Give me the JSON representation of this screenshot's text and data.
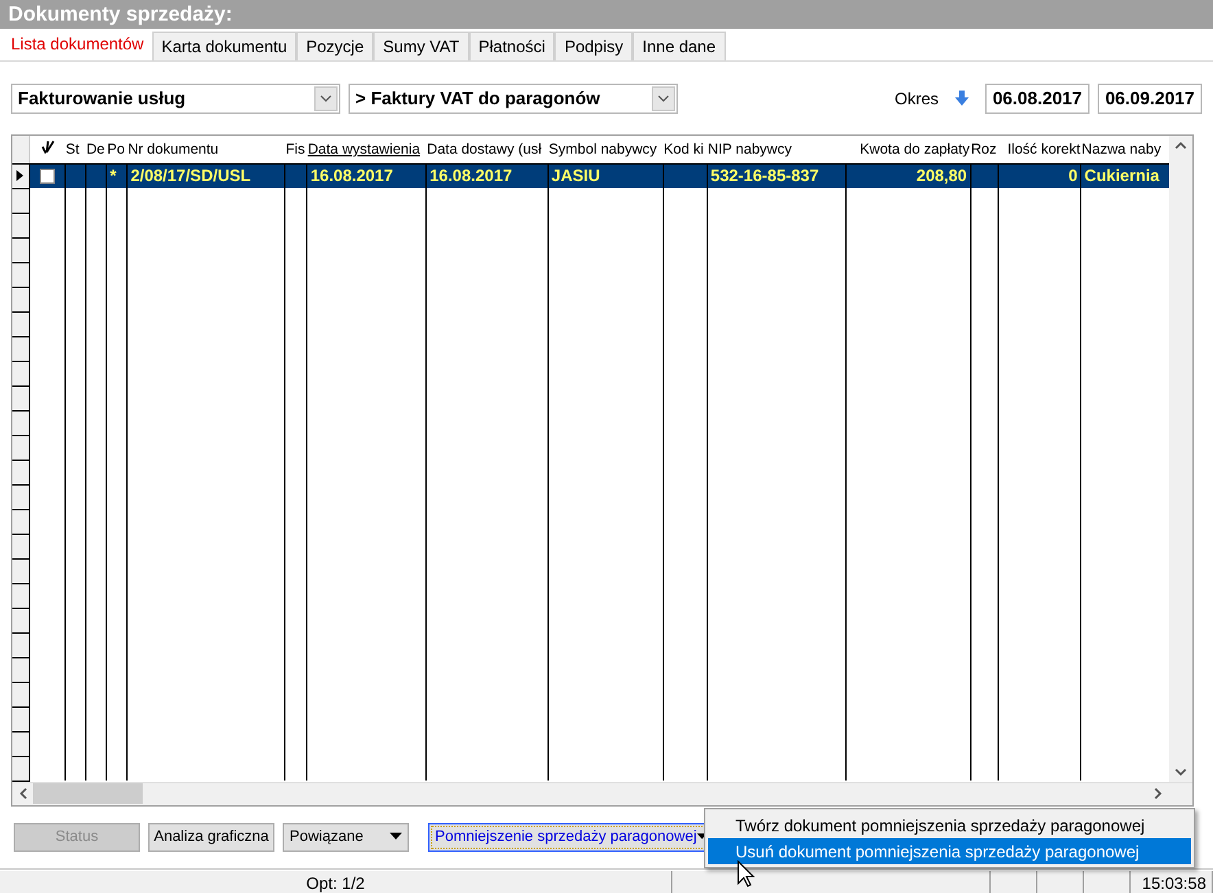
{
  "window": {
    "title": "Dokumenty sprzedaży:"
  },
  "tabs": [
    {
      "label": "Lista dokumentów",
      "selected": true
    },
    {
      "label": "Karta dokumentu",
      "selected": false
    },
    {
      "label": "Pozycje",
      "selected": false
    },
    {
      "label": "Sumy VAT",
      "selected": false
    },
    {
      "label": "Płatności",
      "selected": false
    },
    {
      "label": "Podpisy",
      "selected": false
    },
    {
      "label": "Inne dane",
      "selected": false
    }
  ],
  "filters": {
    "category": "Fakturowanie usług",
    "document_type": "> Faktury VAT do paragonów",
    "period_label": "Okres",
    "date_from": "06.08.2017",
    "date_to": "06.09.2017"
  },
  "table": {
    "columns": [
      {
        "kind": "check"
      },
      {
        "label": "St",
        "sorted": false
      },
      {
        "label": "De",
        "sorted": false
      },
      {
        "label": "Po",
        "sorted": false
      },
      {
        "label": "Nr dokumentu",
        "sorted": false
      },
      {
        "label": "Fis",
        "sorted": false
      },
      {
        "label": "Data wystawienia",
        "sorted": true
      },
      {
        "label": "Data dostawy (usł",
        "sorted": false
      },
      {
        "label": "Symbol nabywcy",
        "sorted": false
      },
      {
        "label": "Kod ki",
        "sorted": false
      },
      {
        "label": "NIP nabywcy",
        "sorted": false
      },
      {
        "label": "Kwota do zapłaty",
        "sorted": false,
        "right_aligned": true
      },
      {
        "label": "Roz",
        "sorted": false
      },
      {
        "label": "Ilość korekt",
        "sorted": false,
        "right_aligned": true
      },
      {
        "label": "Nazwa naby",
        "sorted": false
      }
    ],
    "rows": [
      {
        "selected": true,
        "checked": false,
        "cells": [
          "",
          "",
          "",
          "*",
          "2/08/17/SD/USL",
          "",
          "16.08.2017",
          "16.08.2017",
          "JASIU",
          "",
          "532-16-85-837",
          "208,80",
          "",
          "0",
          "Cukiernia"
        ]
      }
    ]
  },
  "buttons": [
    {
      "label": "Status",
      "kind": "plain",
      "disabled": true,
      "focused": false
    },
    {
      "label": "Analiza graficzna",
      "kind": "plain",
      "disabled": false,
      "focused": false
    },
    {
      "label": "Powiązane",
      "kind": "dropdown",
      "disabled": false,
      "focused": false
    },
    {
      "label": "Pomniejszenie sprzedaży paragonowej",
      "kind": "dropdown",
      "disabled": false,
      "focused": true
    }
  ],
  "menu": {
    "items": [
      {
        "label": "Twórz dokument pomniejszenia sprzedaży paragonowej",
        "selected": false
      },
      {
        "label": "Usuń dokument pomniejszenia sprzedaży paragonowej",
        "selected": true
      }
    ]
  },
  "status_bar": {
    "info": "Opt: 1/2",
    "time": "15:03:58"
  }
}
